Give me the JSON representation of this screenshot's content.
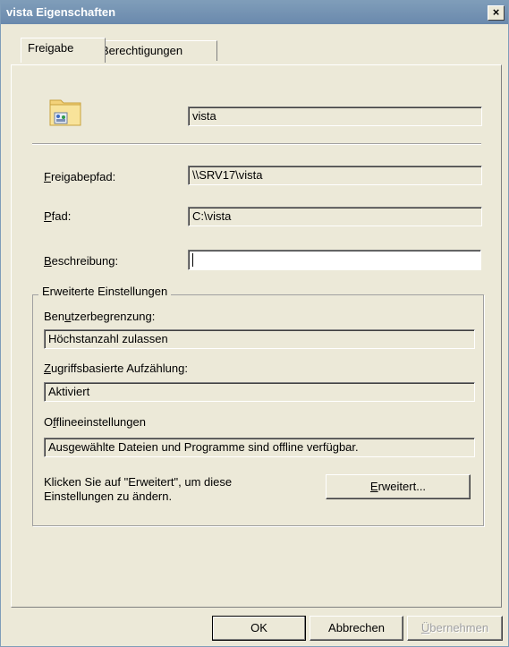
{
  "window": {
    "title": "vista Eigenschaften",
    "close_label": "×"
  },
  "tabs": [
    {
      "label": "Freigabe"
    },
    {
      "label": "Berechtigungen"
    }
  ],
  "share": {
    "name_value": "vista",
    "path_label": "Freigabepfad:",
    "path_label_u": "F",
    "path_label_rest": "reigabepfad:",
    "path_value": "\\\\SRV17\\vista",
    "local_label_u": "P",
    "local_label_rest": "fad:",
    "local_value": "C:\\vista",
    "desc_label_u": "B",
    "desc_label_rest": "eschreibung:",
    "desc_value": ""
  },
  "advanced": {
    "group_title": "Erweiterte Einstellungen",
    "user_limit_label_a": "Ben",
    "user_limit_label_u": "u",
    "user_limit_label_b": "tzerbegrenzung:",
    "user_limit_value": "Höchstanzahl zulassen",
    "abe_label_u": "Z",
    "abe_label_rest": "ugriffsbasierte Aufzählung:",
    "abe_value": "Aktiviert",
    "offline_label_a": "O",
    "offline_label_u": "f",
    "offline_label_b": "flineeinstellungen",
    "offline_value": "Ausgewählte Dateien und Programme sind offline verfügbar.",
    "hint_line1": "Klicken Sie auf \"Erweitert\", um diese",
    "hint_line2": "Einstellungen zu ändern.",
    "button_u": "E",
    "button_rest": "rweitert..."
  },
  "footer": {
    "ok": "OK",
    "cancel": "Abbrechen",
    "apply_u": "Ü",
    "apply_rest": "bernehmen"
  },
  "icons": {
    "folder": "shared-folder-icon",
    "close": "close-icon"
  },
  "colors": {
    "titlebar": "#7f9db9",
    "dialog_bg": "#ece9d8"
  }
}
